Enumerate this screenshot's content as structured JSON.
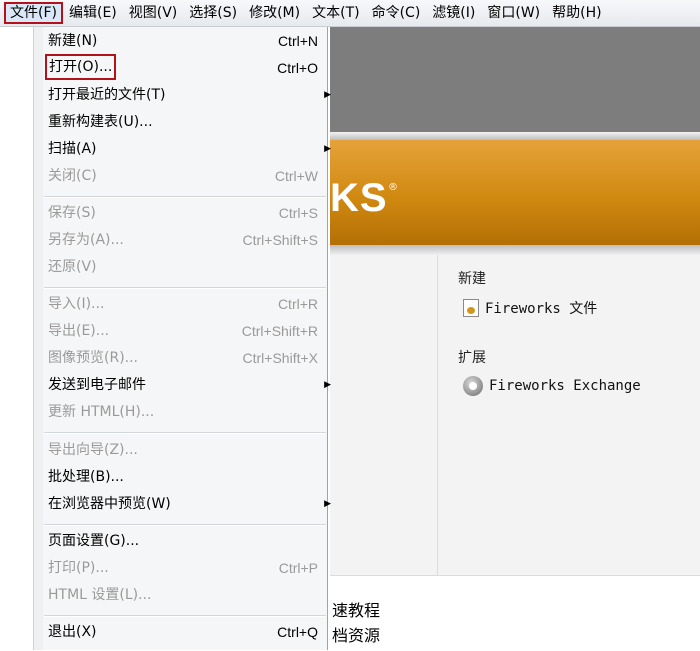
{
  "menubar": {
    "items": [
      "文件(F)",
      "编辑(E)",
      "视图(V)",
      "选择(S)",
      "修改(M)",
      "文本(T)",
      "命令(C)",
      "滤镜(I)",
      "窗口(W)",
      "帮助(H)"
    ]
  },
  "file_menu": {
    "new": {
      "label": "新建(N)",
      "shortcut": "Ctrl+N"
    },
    "open": {
      "label": "打开(O)...",
      "shortcut": "Ctrl+O"
    },
    "open_recent": {
      "label": "打开最近的文件(T)"
    },
    "rebuild_table": {
      "label": "重新构建表(U)..."
    },
    "scan": {
      "label": "扫描(A)"
    },
    "close": {
      "label": "关闭(C)",
      "shortcut": "Ctrl+W"
    },
    "save": {
      "label": "保存(S)",
      "shortcut": "Ctrl+S"
    },
    "save_as": {
      "label": "另存为(A)...",
      "shortcut": "Ctrl+Shift+S"
    },
    "revert": {
      "label": "还原(V)"
    },
    "import": {
      "label": "导入(I)...",
      "shortcut": "Ctrl+R"
    },
    "export": {
      "label": "导出(E)...",
      "shortcut": "Ctrl+Shift+R"
    },
    "image_preview": {
      "label": "图像预览(R)...",
      "shortcut": "Ctrl+Shift+X"
    },
    "send_email": {
      "label": "发送到电子邮件"
    },
    "update_html": {
      "label": "更新 HTML(H)..."
    },
    "export_wizard": {
      "label": "导出向导(Z)..."
    },
    "batch": {
      "label": "批处理(B)..."
    },
    "preview_browser": {
      "label": "在浏览器中预览(W)"
    },
    "page_setup": {
      "label": "页面设置(G)..."
    },
    "print": {
      "label": "打印(P)...",
      "shortcut": "Ctrl+P"
    },
    "html_settings": {
      "label": "HTML 设置(L)..."
    },
    "exit": {
      "label": "退出(X)",
      "shortcut": "Ctrl+Q"
    }
  },
  "start_page": {
    "logo_fragment": "KS",
    "logo_reg": "®",
    "new_heading": "新建",
    "new_link": "Fireworks 文件",
    "extend_heading": "扩展",
    "extend_link": "Fireworks Exchange",
    "footer_line1": "速教程",
    "footer_line2": "档资源"
  },
  "colors": {
    "highlight_border": "#b3121a",
    "banner_orange": "#d08910"
  }
}
